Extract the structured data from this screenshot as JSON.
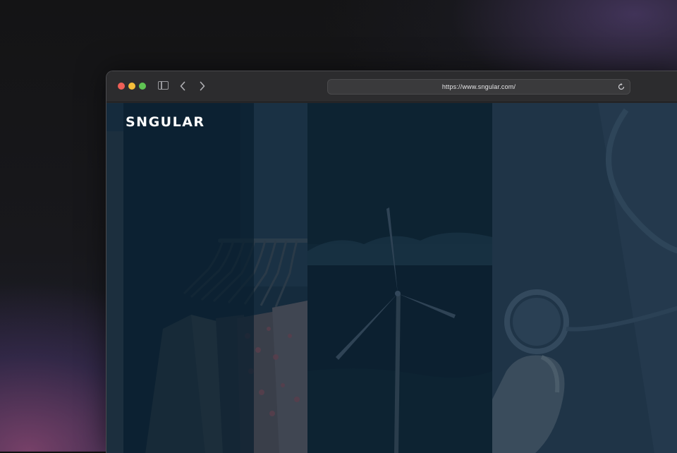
{
  "browser": {
    "url": "https://www.sngular.com/",
    "icons": [
      "close-dot",
      "minimize-dot",
      "maximize-dot",
      "sidebar-icon",
      "back-icon",
      "forward-icon",
      "reload-icon"
    ]
  },
  "site": {
    "logo": "SNGULAR"
  },
  "hero": {
    "panels": [
      {
        "subject": "clothing-rack-photo"
      },
      {
        "subject": "wind-turbine-photo"
      },
      {
        "subject": "stethoscope-photo"
      }
    ]
  },
  "colors": {
    "overlay_navy": "#0f2432",
    "chrome": "#2c2c2e",
    "close": "#ee5f57",
    "minimize": "#f4bd3a",
    "maximize": "#5fc453"
  }
}
